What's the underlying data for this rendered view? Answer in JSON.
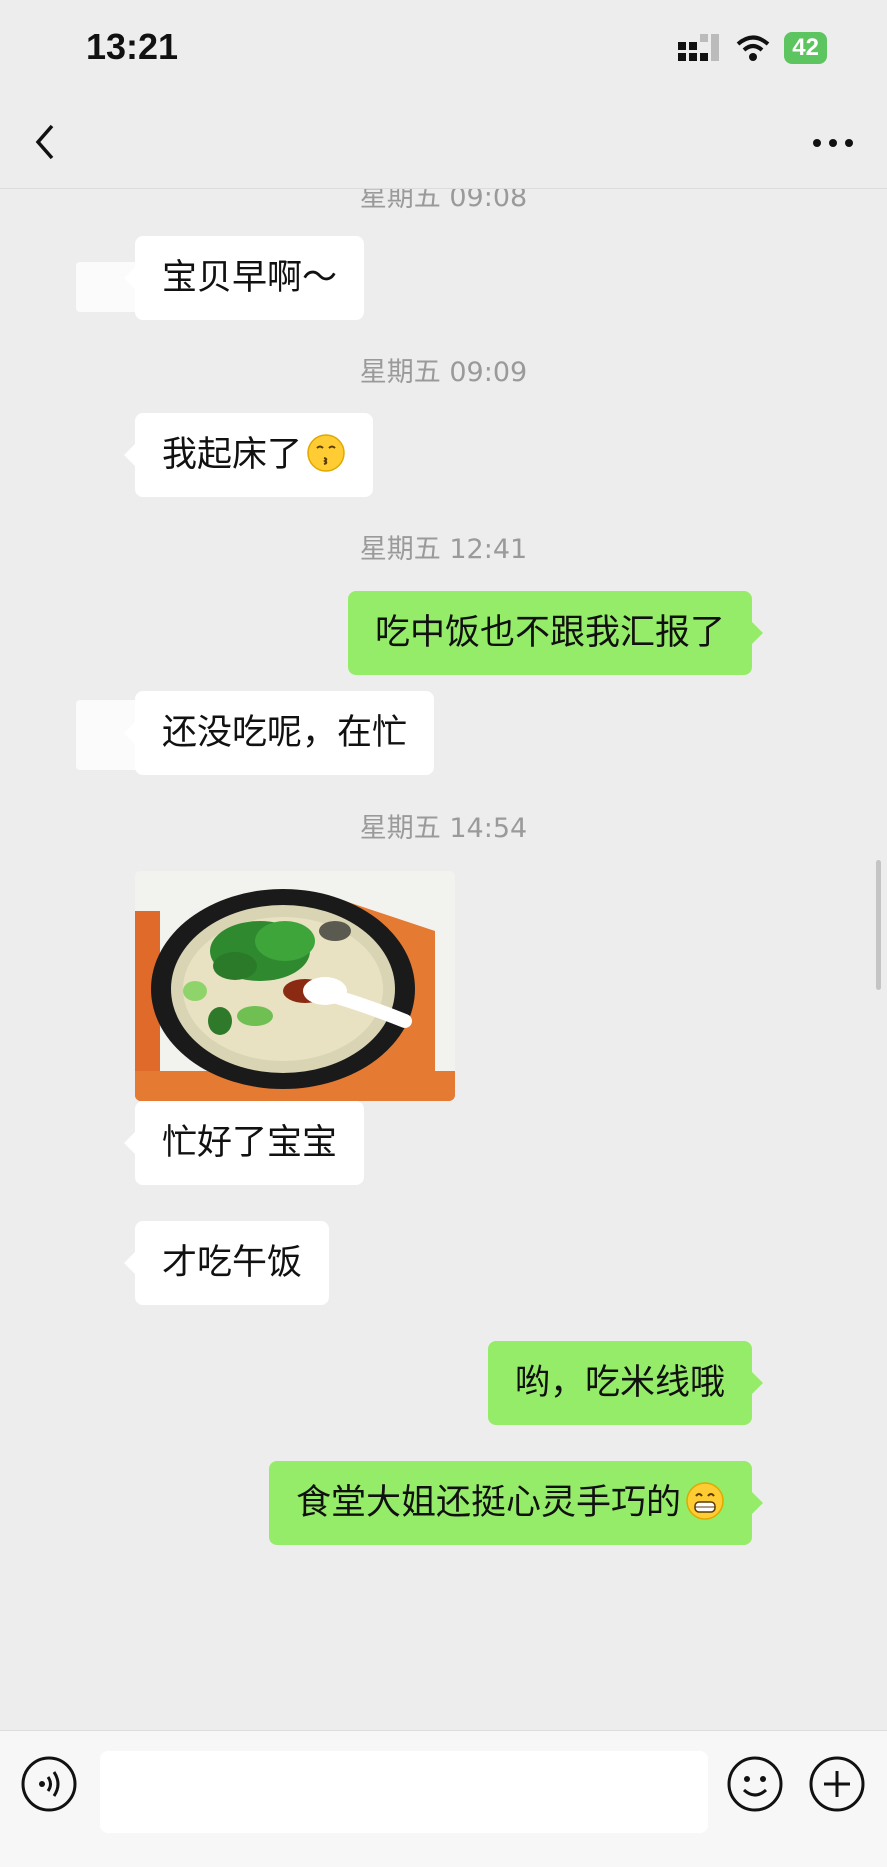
{
  "status_bar": {
    "time": "13:21",
    "battery": "42"
  },
  "messages": [
    {
      "type": "timestamp",
      "text": "星期五 09:08"
    },
    {
      "type": "incoming",
      "text": "宝贝早啊～"
    },
    {
      "type": "timestamp",
      "text": "星期五 09:09"
    },
    {
      "type": "incoming",
      "text": "我起床了",
      "emoji": "kissing-face-emoji"
    },
    {
      "type": "timestamp",
      "text": "星期五 12:41"
    },
    {
      "type": "outgoing",
      "text": "吃中饭也不跟我汇报了"
    },
    {
      "type": "incoming",
      "text": "还没吃呢，在忙"
    },
    {
      "type": "timestamp",
      "text": "星期五 14:54"
    },
    {
      "type": "incoming-image",
      "image": "rice-noodle-bowl-photo"
    },
    {
      "type": "incoming",
      "text": "忙好了宝宝"
    },
    {
      "type": "incoming",
      "text": "才吃午饭"
    },
    {
      "type": "outgoing",
      "text": "哟，吃米线哦"
    },
    {
      "type": "outgoing",
      "text": "食堂大姐还挺心灵手巧的",
      "emoji": "grinning-face-emoji"
    }
  ],
  "colors": {
    "outgoing_bubble": "#95ec69",
    "incoming_bubble": "#ffffff",
    "background": "#ededed"
  },
  "icons": {
    "back": "back-chevron-icon",
    "more": "more-dots-icon",
    "voice": "voice-icon",
    "emoji": "emoji-icon",
    "plus": "plus-icon"
  }
}
